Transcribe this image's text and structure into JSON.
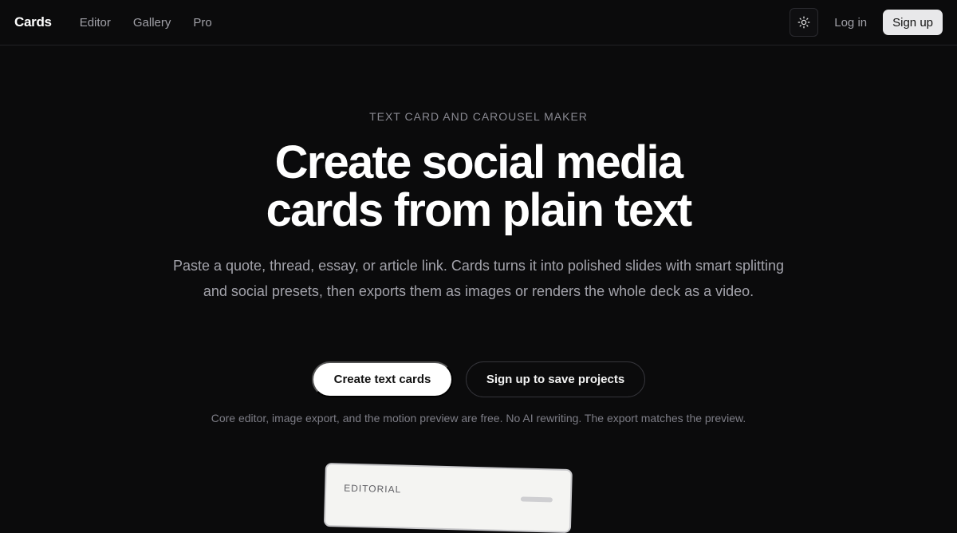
{
  "nav": {
    "brand": "Cards",
    "links": [
      "Editor",
      "Gallery",
      "Pro"
    ],
    "theme_icon": "sun-icon",
    "login": "Log in",
    "signup": "Sign up"
  },
  "hero": {
    "eyebrow": "TEXT CARD AND CAROUSEL MAKER",
    "headline": [
      "Create social media",
      "cards from plain text"
    ],
    "subtext": "Paste a quote, thread, essay, or article link. Cards turns it into polished slides with smart splitting and social presets, then exports them as images or renders the whole deck as a video.",
    "primary_cta": "Create text cards",
    "secondary_cta": "Sign up to save projects",
    "note": "Core editor, image export, and the motion preview are free. No AI rewriting. The export matches the preview."
  },
  "preview_card": {
    "label": "EDITORIAL"
  }
}
